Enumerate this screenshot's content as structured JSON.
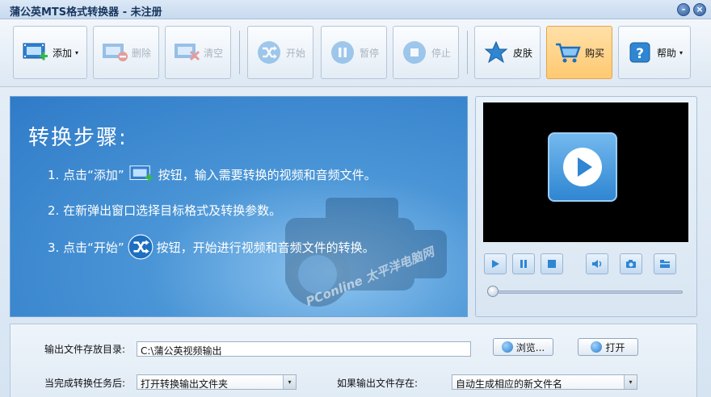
{
  "window": {
    "title": "蒲公英MTS格式转换器 - 未注册",
    "min_glyph": "-",
    "close_glyph": "×"
  },
  "toolbar": {
    "add_label": "添加",
    "delete_label": "删除",
    "clear_label": "清空",
    "start_label": "开始",
    "pause_label": "暂停",
    "stop_label": "停止",
    "skin_label": "皮肤",
    "buy_label": "购买",
    "help_label": "帮助",
    "dropdown_glyph": "▾"
  },
  "guide": {
    "heading": "转换步骤:",
    "step1_a": "1. 点击“添加”",
    "step1_b": "按钮，输入需要转换的视频和音频文件。",
    "step2": "2. 在新弹出窗口选择目标格式及转换参数。",
    "step3_a": "3. 点击“开始”",
    "step3_b": "按钮，开始进行视频和音频文件的转换。",
    "watermark": "PConline 太平洋电脑网"
  },
  "settings": {
    "output_dir_label": "输出文件存放目录:",
    "output_dir_value": "C:\\蒲公英视频输出",
    "browse_label": "浏览...",
    "open_label": "打开",
    "after_task_label": "当完成转换任务后:",
    "after_task_value": "打开转换输出文件夹",
    "if_exists_label": "如果输出文件存在:",
    "if_exists_value": "自动生成相应的新文件名"
  },
  "player": {
    "progress": 0
  },
  "colors": {
    "accent": "#2f86d2",
    "buy_highlight": "#ffc971",
    "guide_bg": "#3a86cf"
  }
}
